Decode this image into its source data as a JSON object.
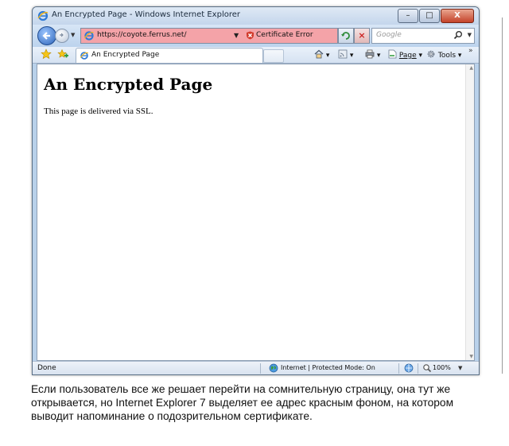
{
  "window": {
    "title": "An Encrypted Page - Windows Internet Explorer",
    "buttons": {
      "minimize": "–",
      "maximize": "□",
      "close": "X"
    }
  },
  "navbar": {
    "address_url": "https://coyote.ferrus.net/",
    "certificate_error_label": "Certificate Error",
    "address_background_color": "#f4a3a8",
    "search_placeholder": "Google"
  },
  "tabbar": {
    "tab_label": "An Encrypted Page",
    "page_menu": "Page",
    "tools_menu": "Tools"
  },
  "page": {
    "heading": "An Encrypted Page",
    "text": "This page is delivered via SSL."
  },
  "statusbar": {
    "status_text": "Done",
    "zone_text": "Internet | Protected Mode: On",
    "zoom": "100%"
  },
  "caption": "Если пользователь все же решает перейти на сомнительную страницу, она тут же открывается, но Internet Explorer 7 выделяет ее адрес красным фоном, на котором выводит напоминание о подозрительном сертификате."
}
